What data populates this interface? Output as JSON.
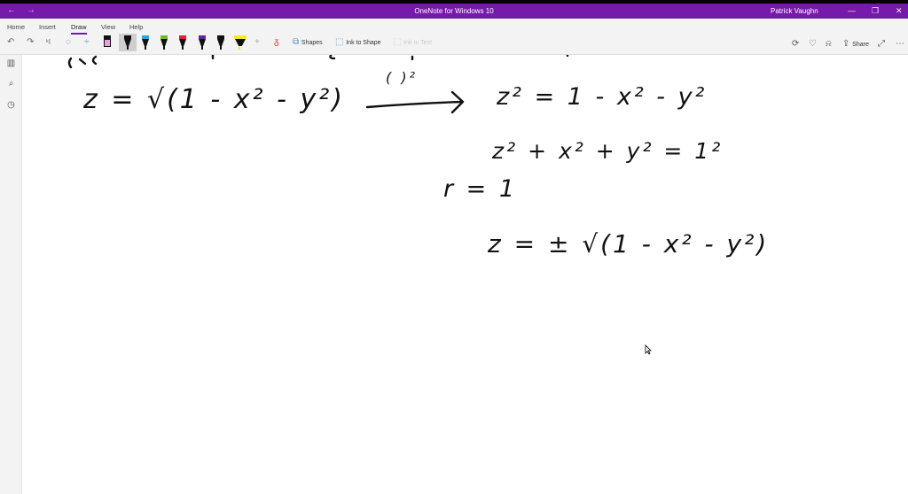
{
  "window": {
    "title": "OneNote for Windows 10",
    "user": "Patrick Vaughn",
    "back": "←",
    "forward": "→",
    "minimize": "—",
    "restore": "❐",
    "close": "✕"
  },
  "ribbon": {
    "tabs": [
      {
        "label": "Home"
      },
      {
        "label": "Insert"
      },
      {
        "label": "Draw"
      },
      {
        "label": "View"
      },
      {
        "label": "Help"
      }
    ],
    "active_tab": "Draw",
    "tools": {
      "undo": "↶",
      "redo": "↷",
      "type": "ᵏI",
      "lasso": "◌",
      "space": "÷",
      "add": "+",
      "replay": "ᵹ"
    },
    "shapes_label": "Shapes",
    "ink_to_shape_label": "Ink to Shape",
    "ink_to_text_label": "Ink to Text",
    "share_label": "Share",
    "pens": [
      {
        "color": "#e7a1e8",
        "type": "eraser"
      },
      {
        "color": "#111111",
        "type": "pen"
      },
      {
        "color": "#2aa3e0",
        "type": "pen"
      },
      {
        "color": "#6dbb1f",
        "type": "pen"
      },
      {
        "color": "#e0212e",
        "type": "pen"
      },
      {
        "color": "#5b2a9a",
        "type": "pen"
      },
      {
        "color": "#111111",
        "type": "pen"
      },
      {
        "color": "#f5ea1c",
        "type": "highlighter"
      }
    ]
  },
  "note": {
    "ink": [
      "z = √(1 - x² - y²)",
      "( )²",
      "z² = 1 - x² - y²",
      "z² + x² + y² = 1²",
      "r = 1",
      "z = ± √(1 - x² - y²)"
    ]
  },
  "colors": {
    "accent": "#7719aa"
  }
}
